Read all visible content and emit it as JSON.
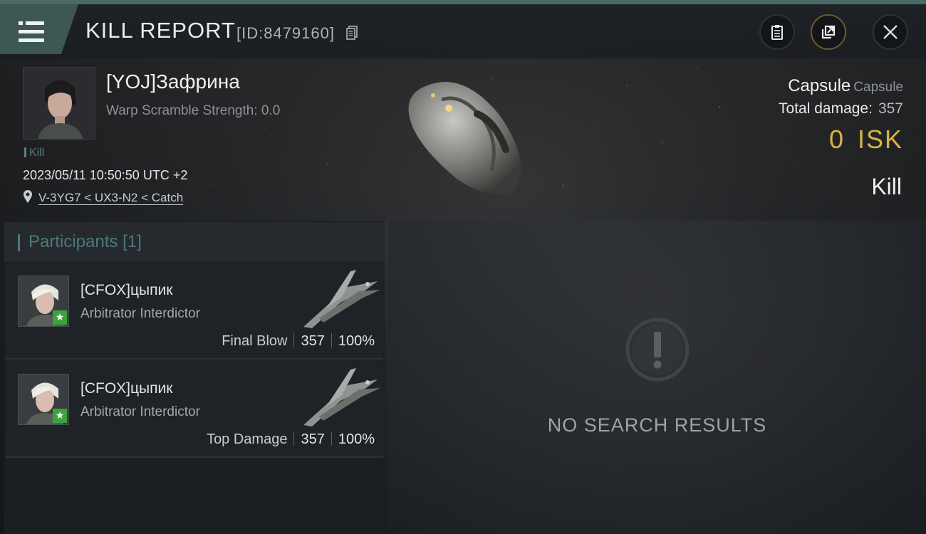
{
  "header": {
    "title": "KILL REPORT",
    "report_id": "[ID:8479160]"
  },
  "victim": {
    "name": "[YOJ]Зафрина",
    "warp_scramble": "Warp Scramble Strength: 0.0",
    "tag": "Kill",
    "datetime": "2023/05/11 10:50:50 UTC +2",
    "location": "V-3YG7 < UX3-N2 < Catch",
    "ship_name": "Capsule",
    "ship_class": "Capsule",
    "total_damage_label": "Total damage:",
    "total_damage": "357",
    "isk_value": "0",
    "isk_unit": "ISK",
    "kill_type": "Kill"
  },
  "participants": {
    "title": "Participants",
    "count": "[1]",
    "rows": [
      {
        "name": "[CFOX]цыпик",
        "ship": "Arbitrator Interdictor",
        "label": "Final Blow",
        "damage": "357",
        "percent": "100%"
      },
      {
        "name": "[CFOX]цыпик",
        "ship": "Arbitrator Interdictor",
        "label": "Top Damage",
        "damage": "357",
        "percent": "100%"
      }
    ]
  },
  "results": {
    "empty_text": "NO SEARCH RESULTS"
  },
  "colors": {
    "accent_teal": "#4d7a76",
    "isk_gold": "#d9b246",
    "badge_green": "#3aa43c"
  },
  "icons": [
    "menu-icon",
    "copy-icon",
    "clipboard-icon",
    "share-icon",
    "close-icon",
    "location-pin-icon",
    "alert-icon",
    "star-icon"
  ]
}
